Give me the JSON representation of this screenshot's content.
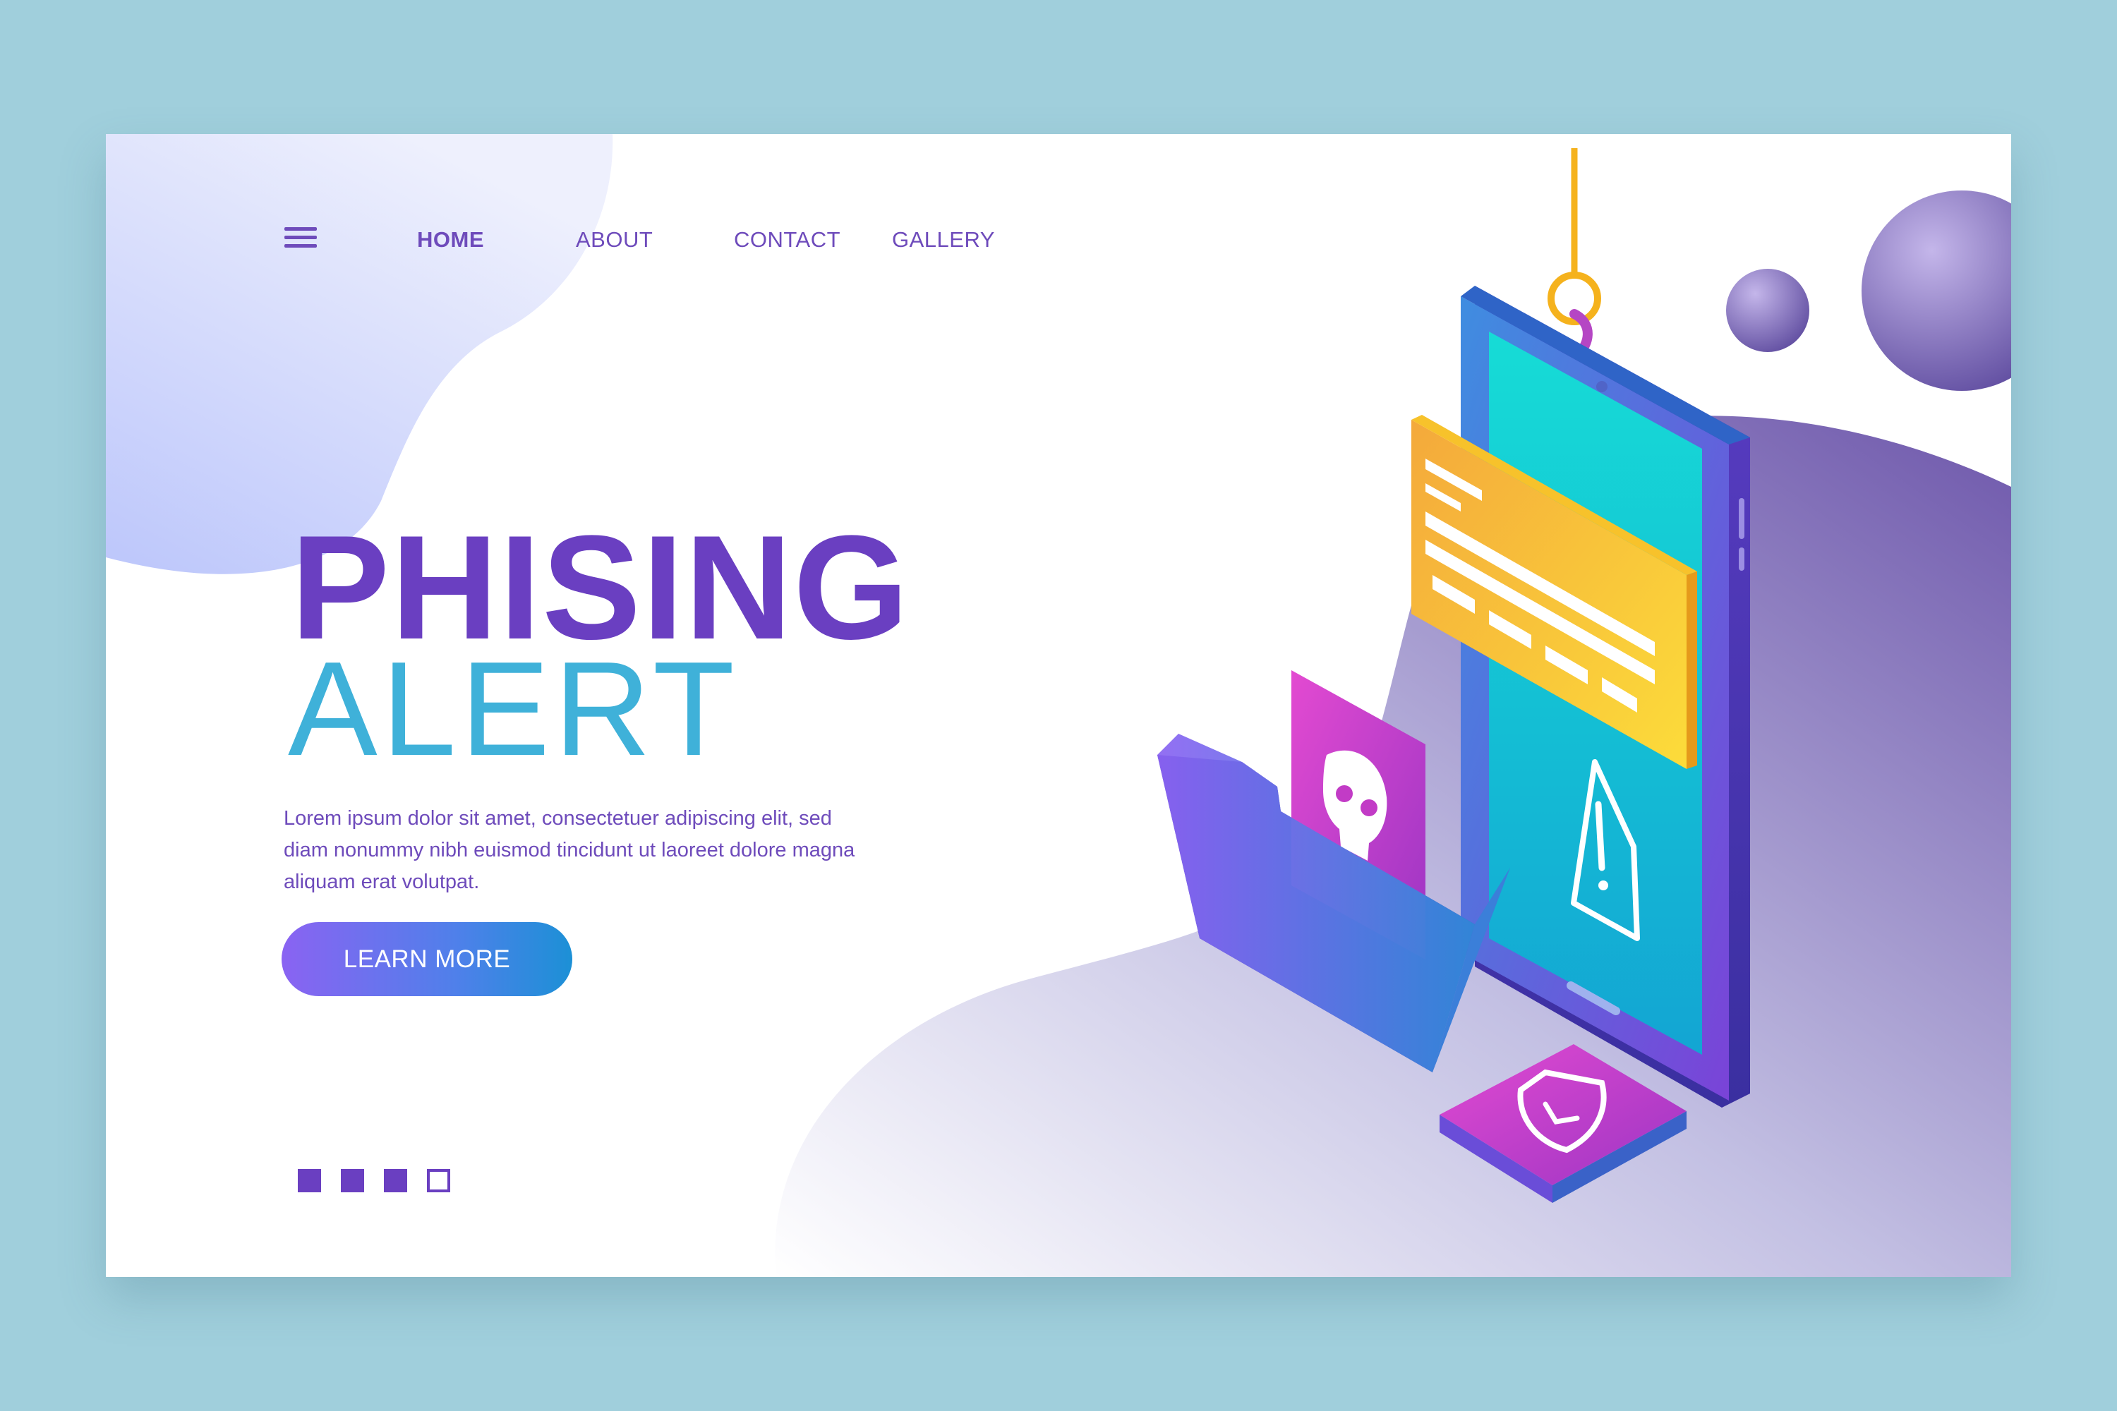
{
  "nav": {
    "menu_icon": "hamburger-menu-icon",
    "items": [
      {
        "label": "HOME",
        "active": true
      },
      {
        "label": "ABOUT",
        "active": false
      },
      {
        "label": "CONTACT",
        "active": false
      },
      {
        "label": "GALLERY",
        "active": false
      }
    ]
  },
  "hero": {
    "title": "PHISING",
    "subtitle": "ALERT",
    "body": "Lorem ipsum dolor sit amet, consectetuer adipiscing elit, sed diam nonummy nibh euismod tincidunt ut laoreet dolore magna aliquam erat volutpat.",
    "cta_label": "LEARN MORE"
  },
  "pagination": {
    "total": 4,
    "states": [
      "filled",
      "filled",
      "filled",
      "outline"
    ]
  },
  "illustration": {
    "icons": [
      "fishing-hook-icon",
      "smartphone-icon",
      "warning-triangle-icon",
      "skull-icon",
      "folder-icon",
      "shield-check-icon",
      "email-card-icon"
    ]
  },
  "colors": {
    "page_background": "#a0cfdc",
    "primary_purple": "#6a3fc1",
    "accent_cyan": "#3fb1d9",
    "phone_screen": "#16c9d8",
    "card_yellow": "#f9c631",
    "magenta": "#d43fc2"
  }
}
